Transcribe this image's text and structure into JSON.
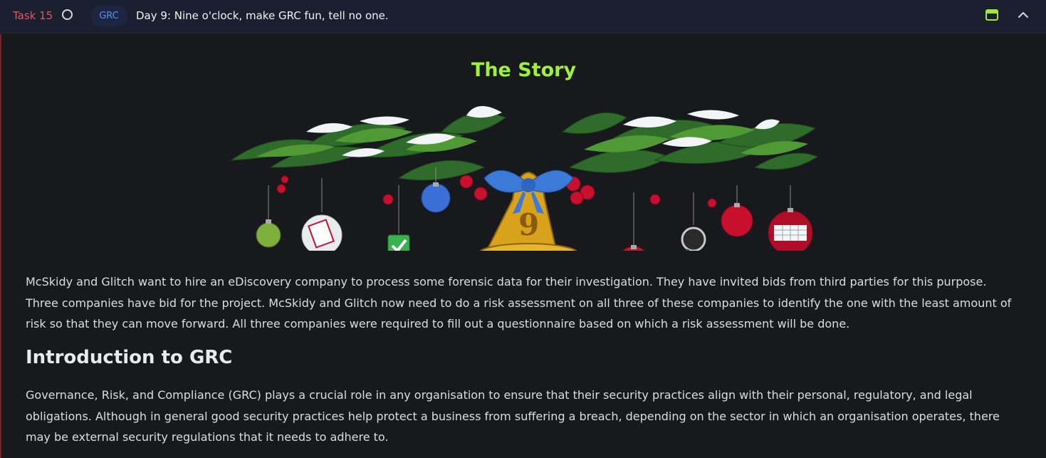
{
  "task": {
    "number_label": "Task 15",
    "tag": "GRC",
    "title": "Day 9: Nine o'clock, make GRC fun, tell no one."
  },
  "colors": {
    "header_bg": "#1b2030",
    "page_bg": "#18191c",
    "task_number": "#e0555f",
    "tag_text": "#5e8ef0",
    "tag_bg": "#1d2640",
    "story_title": "#9ff03a",
    "window_icon": "#a3e635",
    "body_text": "#dcdde1",
    "left_accent": "#7a1f2a"
  },
  "icons": {
    "status": "empty-circle-icon",
    "window": "window-icon",
    "collapse": "chevron-up-icon"
  },
  "content": {
    "story_title": "The Story",
    "banner_image": "christmas-garland-bell-9-illustration",
    "story_paragraph": "McSkidy and Glitch want to hire an eDiscovery company to process some forensic data for their investigation. They have invited bids from third parties for this purpose. Three companies have bid for the project. McSkidy and Glitch now need to do a risk assessment on all three of these companies to identify the one with the least amount of risk so that they can move forward. All three companies were required to fill out a questionnaire based on which a risk assessment will be done.",
    "section_heading": "Introduction to GRC",
    "grc_paragraph": "Governance, Risk, and Compliance (GRC) plays a crucial role in any organisation to ensure that their security practices align with their personal, regulatory, and legal obligations. Although in general good security practices help protect a business from suffering a breach, depending on the sector in which an organisation operates, there may be external security regulations that it needs to adhere to."
  }
}
